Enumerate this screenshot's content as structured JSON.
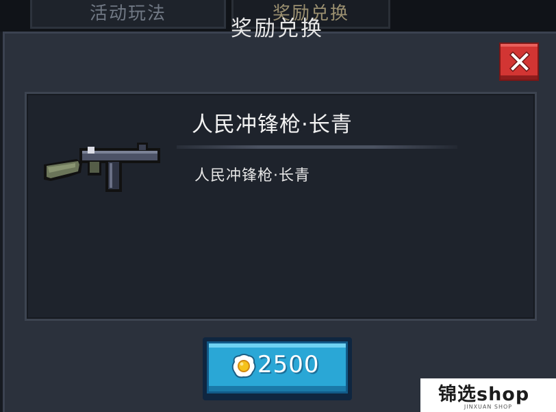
{
  "tabs": [
    {
      "label": "活动玩法"
    },
    {
      "label": "奖励兑换"
    }
  ],
  "dialog": {
    "title": "奖励兑换",
    "close_icon": "close-x-icon"
  },
  "item": {
    "name": "人民冲锋枪·长青",
    "description": "人民冲锋枪·长青",
    "icon": "submachine-gun-icon"
  },
  "purchase": {
    "currency_icon": "fried-egg-icon",
    "price": "2500"
  },
  "watermark": {
    "text": "锦选shop",
    "subtext": "JINXUAN SHOP"
  },
  "colors": {
    "close_button": "#d23533",
    "buy_button": "#2aa7d6",
    "panel": "#2b313c"
  }
}
